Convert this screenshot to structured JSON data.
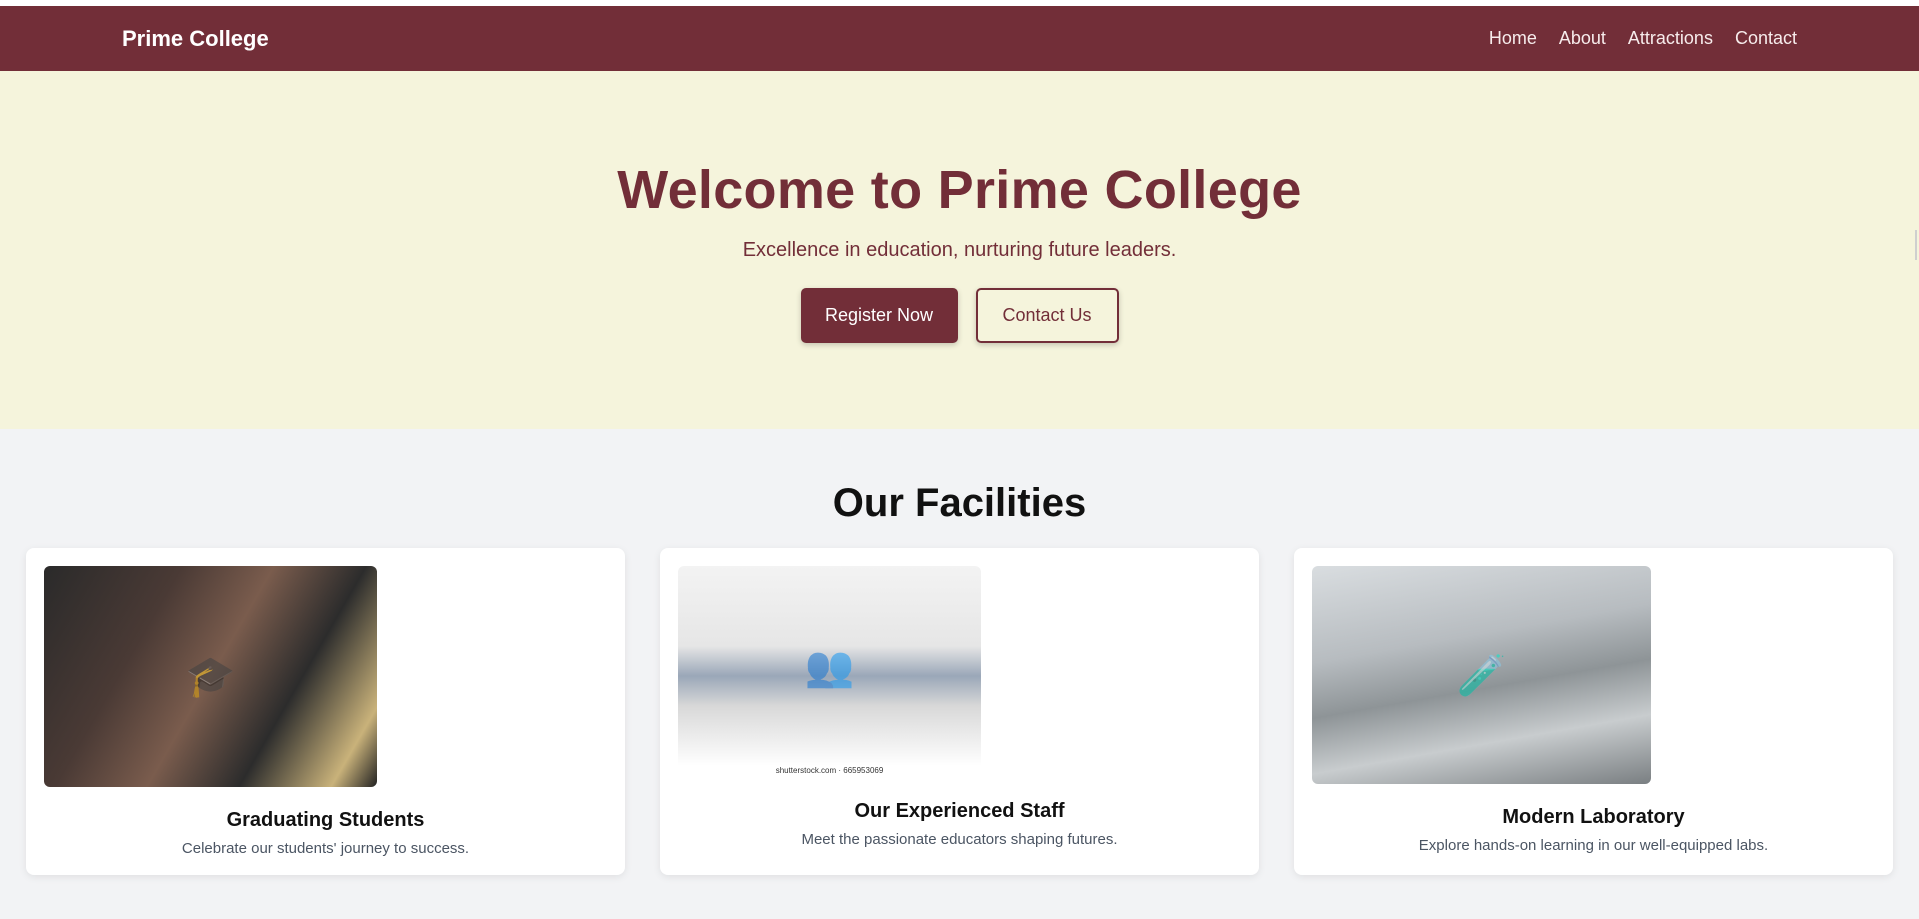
{
  "nav": {
    "brand": "Prime College",
    "links": [
      "Home",
      "About",
      "Attractions",
      "Contact"
    ]
  },
  "hero": {
    "title": "Welcome to Prime College",
    "subtitle": "Excellence in education, nurturing future leaders.",
    "primary_button": "Register Now",
    "secondary_button": "Contact Us"
  },
  "facilities": {
    "title": "Our Facilities",
    "cards": [
      {
        "title": "Graduating Students",
        "desc": "Celebrate our students' journey to success.",
        "icon": "graduates-photo"
      },
      {
        "title": "Our Experienced Staff",
        "desc": "Meet the passionate educators shaping futures.",
        "icon": "staff-photo",
        "caption": "shutterstock.com · 665953069"
      },
      {
        "title": "Modern Laboratory",
        "desc": "Explore hands-on learning in our well-equipped labs.",
        "icon": "laboratory-photo"
      }
    ]
  },
  "colors": {
    "brand": "#722e38",
    "hero_bg": "#f5f4dc",
    "page_bg": "#f2f3f5"
  }
}
